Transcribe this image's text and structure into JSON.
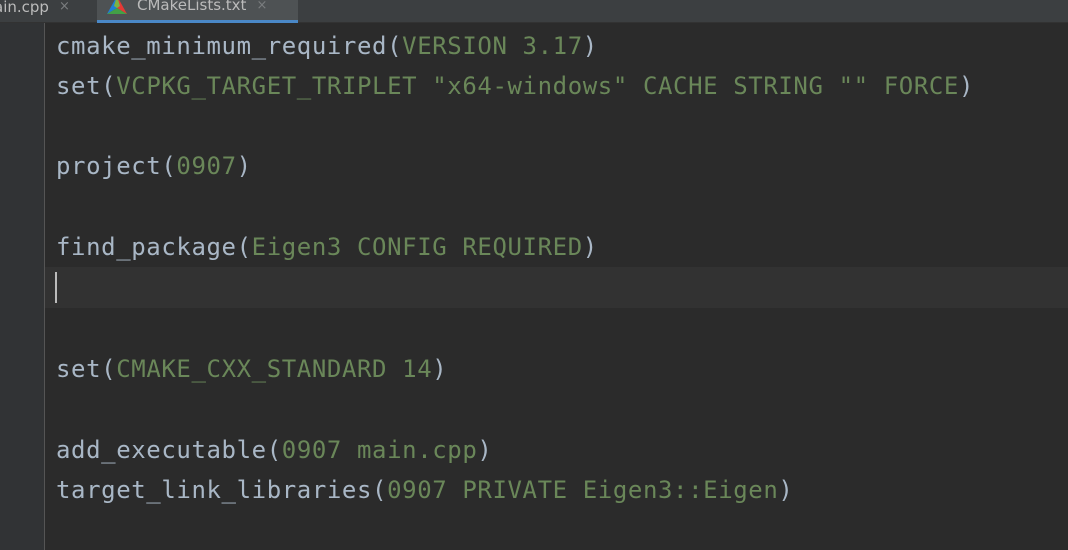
{
  "tabs": [
    {
      "label": "ain.cpp",
      "close": "×",
      "active": false
    },
    {
      "label": "CMakeLists.txt",
      "close": "×",
      "active": true
    }
  ],
  "colors": {
    "background": "#2b2b2b",
    "gutter": "#313335",
    "command": "#a9b7c6",
    "argument": "#6a8759",
    "active_tab_underline": "#4a88c7"
  },
  "editor": {
    "lines": [
      {
        "cmd": "cmake_minimum_required",
        "open": "(",
        "args": "VERSION 3.17",
        "close": ")"
      },
      {
        "cmd": "set",
        "open": "(",
        "args": "VCPKG_TARGET_TRIPLET \"x64-windows\" CACHE STRING \"\" FORCE",
        "close": ")"
      },
      {
        "cmd": "project",
        "open": "(",
        "args": "0907",
        "close": ")"
      },
      {
        "cmd": "find_package",
        "open": "(",
        "args": "Eigen3 CONFIG REQUIRED",
        "close": ")"
      },
      {
        "cmd": "set",
        "open": "(",
        "args": "CMAKE_CXX_STANDARD 14",
        "close": ")"
      },
      {
        "cmd": "add_executable",
        "open": "(",
        "args": "0907 main.cpp",
        "close": ")"
      },
      {
        "cmd": "target_link_libraries",
        "open": "(",
        "args": "0907 PRIVATE Eigen3::Eigen",
        "close": ")"
      }
    ]
  }
}
